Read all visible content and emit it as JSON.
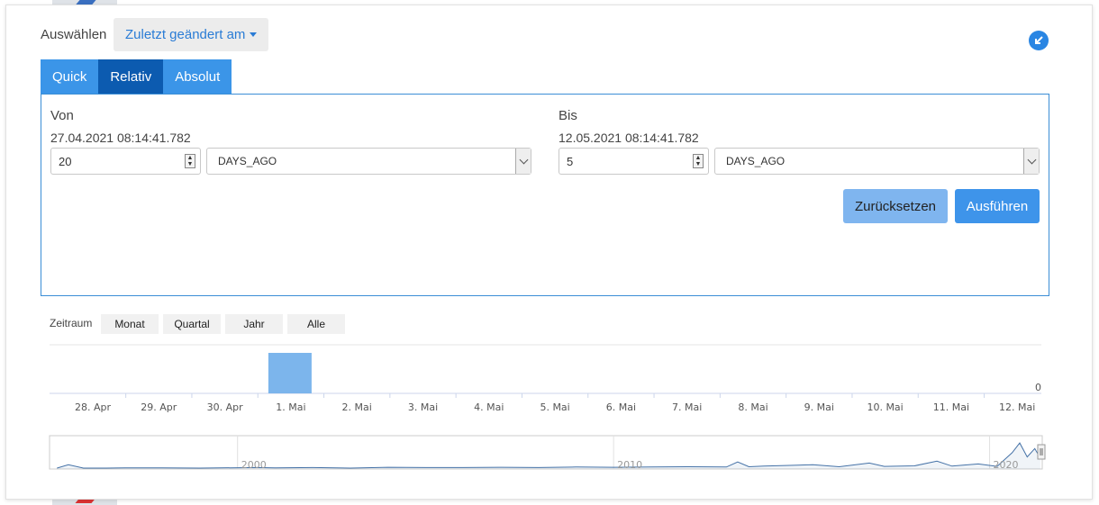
{
  "background": {
    "top_link_text": "",
    "bottom_link_text": ""
  },
  "filter": {
    "select_label": "Auswählen",
    "select_value": "Zuletzt geändert am"
  },
  "collapse_icon": "arrow-down-left-icon",
  "tabs": [
    {
      "label": "Quick",
      "active": false
    },
    {
      "label": "Relativ",
      "active": true
    },
    {
      "label": "Absolut",
      "active": false
    }
  ],
  "from": {
    "label": "Von",
    "date": "27.04.2021 08:14:41.782",
    "amount": "20",
    "unit": "DAYS_AGO"
  },
  "to": {
    "label": "Bis",
    "date": "12.05.2021 08:14:41.782",
    "amount": "5",
    "unit": "DAYS_AGO"
  },
  "buttons": {
    "reset": "Zurücksetzen",
    "execute": "Ausführen"
  },
  "period": {
    "label": "Zeitraum",
    "options": [
      "Monat",
      "Quartal",
      "Jahr",
      "Alle"
    ]
  },
  "colors": {
    "accent": "#2a86e3",
    "active_tab": "#0c5bb0",
    "bar": "#7cb5ec",
    "line": "#4572a7"
  },
  "chart_data": [
    {
      "type": "bar",
      "categories": [
        "28. Apr",
        "29. Apr",
        "30. Apr",
        "1. Mai",
        "2. Mai",
        "3. Mai",
        "4. Mai",
        "5. Mai",
        "6. Mai",
        "7. Mai",
        "8. Mai",
        "9. Mai",
        "10. Mai",
        "11. Mai",
        "12. Mai"
      ],
      "values": [
        0,
        0,
        0,
        1,
        0,
        0,
        0,
        0,
        0,
        0,
        0,
        0,
        0,
        0,
        0
      ],
      "y_label_shown": "0",
      "grid": true
    },
    {
      "type": "line",
      "x_ticks": [
        "2000",
        "2010",
        "2020"
      ],
      "x_range": [
        1995,
        2021.4
      ],
      "series": [
        {
          "values": [
            [
              1995.2,
              0
            ],
            [
              1995.5,
              0.12
            ],
            [
              1995.9,
              0
            ],
            [
              1996.5,
              0
            ],
            [
              1997,
              0.01
            ],
            [
              1998,
              0.01
            ],
            [
              1999,
              0
            ],
            [
              2000.5,
              0.02
            ],
            [
              2001,
              0.01
            ],
            [
              2002,
              0.02
            ],
            [
              2003,
              0
            ],
            [
              2004,
              0.03
            ],
            [
              2005,
              0.02
            ],
            [
              2006,
              0.02
            ],
            [
              2007,
              0.03
            ],
            [
              2008,
              0.02
            ],
            [
              2009,
              0.04
            ],
            [
              2010,
              0.03
            ],
            [
              2011,
              0.04
            ],
            [
              2012,
              0.05
            ],
            [
              2013,
              0.04
            ],
            [
              2013.3,
              0.22
            ],
            [
              2013.6,
              0.05
            ],
            [
              2014,
              0.07
            ],
            [
              2014.8,
              0.1
            ],
            [
              2015.3,
              0.12
            ],
            [
              2016,
              0.05
            ],
            [
              2016.8,
              0.18
            ],
            [
              2017.2,
              0.06
            ],
            [
              2018,
              0.08
            ],
            [
              2018.6,
              0.25
            ],
            [
              2019,
              0.07
            ],
            [
              2019.7,
              0.15
            ],
            [
              2020.2,
              0.06
            ],
            [
              2020.6,
              0.55
            ],
            [
              2020.8,
              0.9
            ],
            [
              2021,
              0.4
            ],
            [
              2021.2,
              0.7
            ],
            [
              2021.35,
              0.35
            ]
          ]
        }
      ]
    }
  ]
}
